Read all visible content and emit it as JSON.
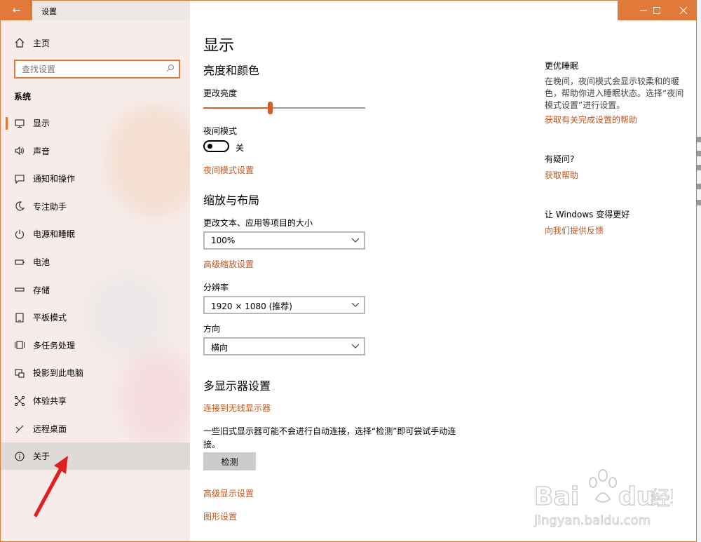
{
  "titlebar": {
    "back_glyph": "←",
    "title": "设置",
    "minimize_glyph": "—",
    "maximize_glyph": "☐",
    "close_glyph": "✕",
    "accent": "#e0793a"
  },
  "sidebar": {
    "home": {
      "icon": "home-icon",
      "label": "主页"
    },
    "search": {
      "placeholder": "查找设置",
      "icon": "search-icon"
    },
    "section": "系统",
    "items": [
      {
        "icon": "monitor-icon",
        "label": "显示",
        "active": true
      },
      {
        "icon": "speaker-icon",
        "label": "声音"
      },
      {
        "icon": "notification-icon",
        "label": "通知和操作"
      },
      {
        "icon": "moon-icon",
        "label": "专注助手"
      },
      {
        "icon": "power-icon",
        "label": "电源和睡眠"
      },
      {
        "icon": "battery-icon",
        "label": "电池"
      },
      {
        "icon": "storage-icon",
        "label": "存储"
      },
      {
        "icon": "tablet-icon",
        "label": "平板模式"
      },
      {
        "icon": "multitask-icon",
        "label": "多任务处理"
      },
      {
        "icon": "project-icon",
        "label": "投影到此电脑"
      },
      {
        "icon": "share-icon",
        "label": "体验共享"
      },
      {
        "icon": "remote-icon",
        "label": "远程桌面"
      },
      {
        "icon": "info-icon",
        "label": "关于",
        "hover": true
      }
    ]
  },
  "main": {
    "title": "显示",
    "brightness": {
      "heading": "亮度和颜色",
      "label": "更改亮度",
      "value": 0.41
    },
    "night": {
      "label": "夜间模式",
      "state": "关",
      "settings_link": "夜间模式设置"
    },
    "scale": {
      "heading": "缩放与布局",
      "size_label": "更改文本、应用等项目的大小",
      "size_value": "100%",
      "advanced_link": "高级缩放设置",
      "resolution_label": "分辨率",
      "resolution_value": "1920 × 1080 (推荐)",
      "orientation_label": "方向",
      "orientation_value": "横向"
    },
    "multi": {
      "heading": "多显示器设置",
      "wireless_link": "连接到无线显示器",
      "note": "一些旧式显示器可能不会进行自动连接，选择“检测”即可尝试手动连接。",
      "detect_button": "检测",
      "advanced_display_link": "高级显示设置",
      "graphics_link": "图形设置"
    }
  },
  "aside": {
    "sleep_title": "更优睡眠",
    "sleep_text": "在晚间，夜间模式会显示较柔和的暖色，帮助你进入睡眠状态。选择“夜间模式设置”进行设置。",
    "sleep_link": "获取有关完成设置的帮助",
    "question_title": "有疑问?",
    "question_link": "获取帮助",
    "improve_title": "让 Windows 变得更好",
    "improve_link": "向我们提供反馈"
  },
  "watermark": {
    "brand": "Bai",
    "brand2": "du",
    "jingyan": "经验",
    "url": "jingyan.baidu.com"
  }
}
